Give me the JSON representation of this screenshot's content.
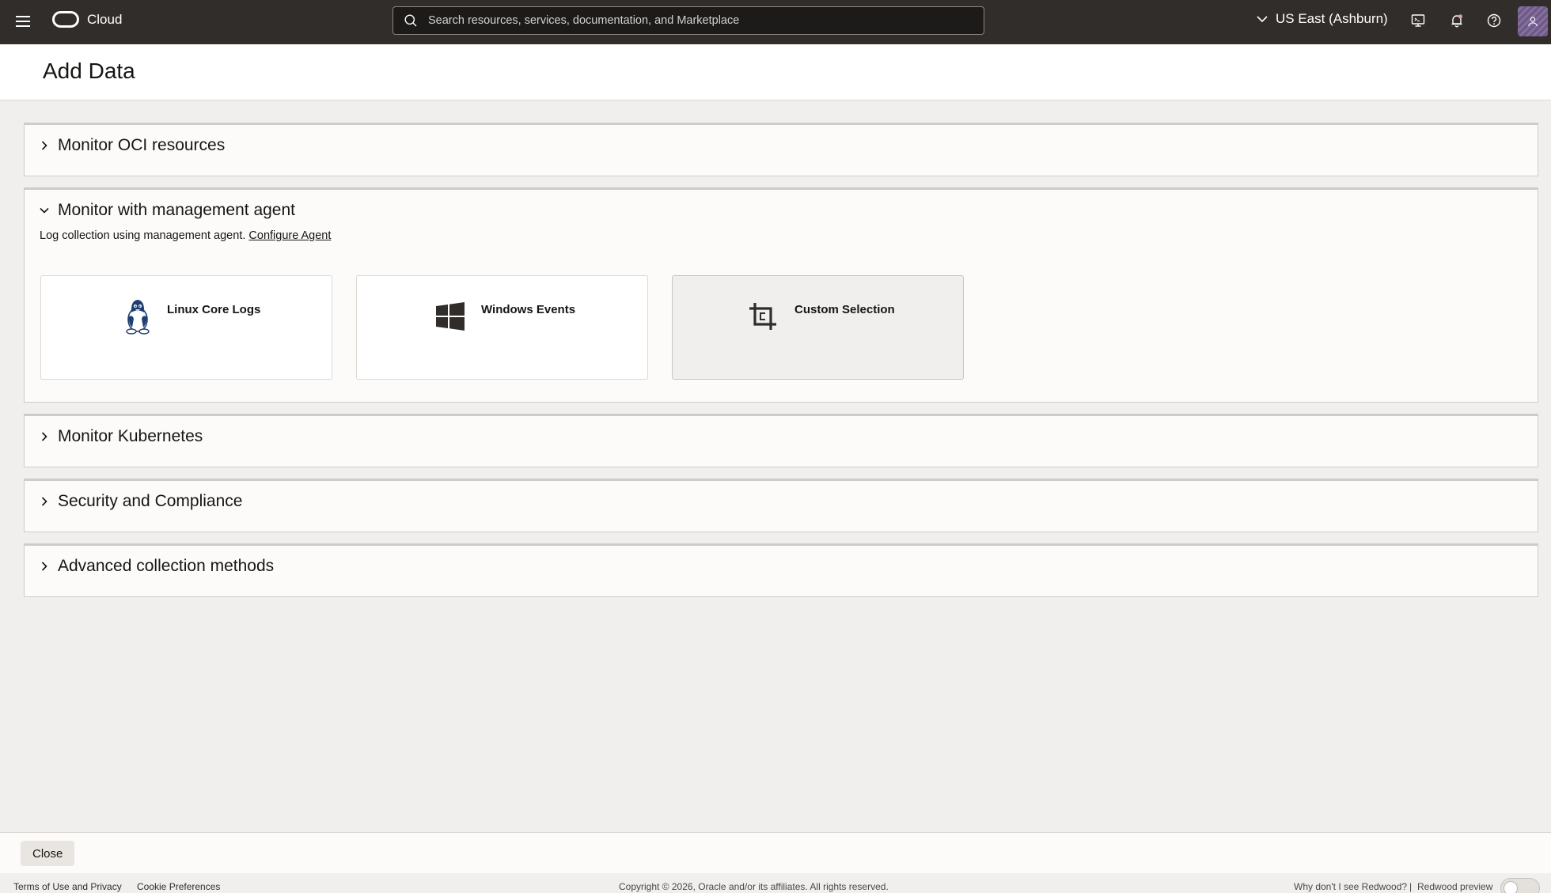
{
  "topbar": {
    "brand": "Cloud",
    "search_placeholder": "Search resources, services, documentation, and Marketplace",
    "region": "US East (Ashburn)",
    "icons": [
      "menu-icon",
      "cloud-shell-icon",
      "bell-icon",
      "help-icon",
      "user-icon"
    ]
  },
  "page": {
    "title": "Add Data"
  },
  "sections": [
    {
      "title": "Monitor OCI resources",
      "expanded": false
    },
    {
      "title": "Monitor with management agent",
      "expanded": true,
      "description": "Log collection using management agent.",
      "link": "Configure Agent",
      "tiles": [
        {
          "label": "Linux Core Logs",
          "icon": "linux-penguin-icon",
          "selected": false
        },
        {
          "label": "Windows Events",
          "icon": "windows-logo-icon",
          "selected": false
        },
        {
          "label": "Custom Selection",
          "icon": "crop-icon",
          "selected": true
        }
      ]
    },
    {
      "title": "Monitor Kubernetes",
      "expanded": false
    },
    {
      "title": "Security and Compliance",
      "expanded": false
    },
    {
      "title": "Advanced collection methods",
      "expanded": false
    }
  ],
  "actions": {
    "close": "Close"
  },
  "footer": {
    "terms": "Terms of Use and Privacy",
    "cookies": "Cookie Preferences",
    "copyright": "Copyright © 2026, Oracle and/or its affiliates. All rights reserved.",
    "redwood_question": "Why don't I see Redwood?",
    "separator": "|",
    "redwood_preview": "Redwood preview"
  }
}
